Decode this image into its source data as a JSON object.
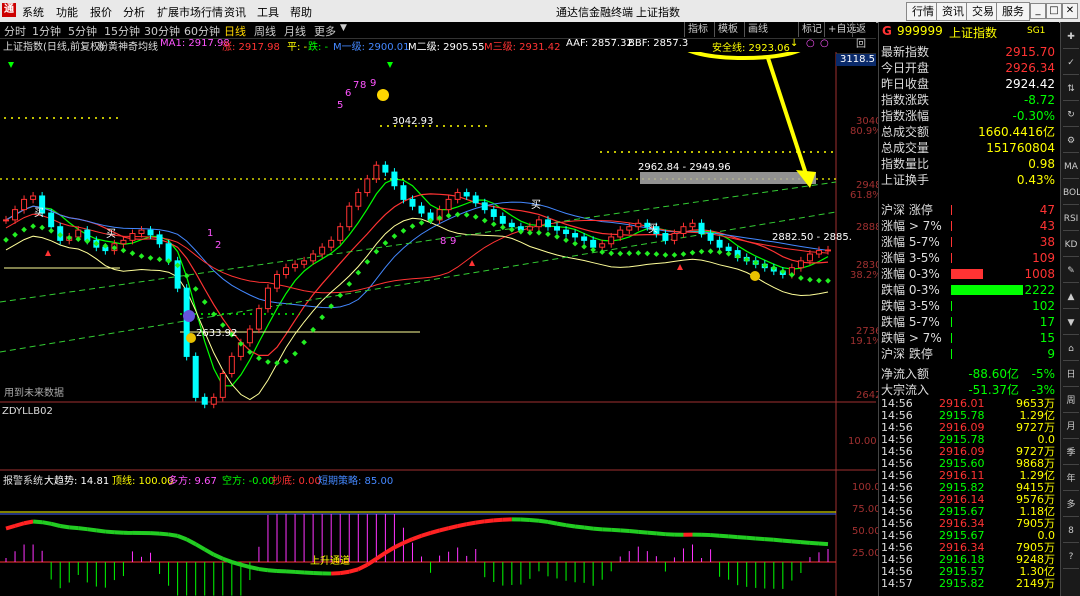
{
  "menubar": {
    "items": [
      "系统",
      "功能",
      "报价",
      "分析",
      "扩展市场行情",
      "资讯",
      "工具",
      "帮助"
    ],
    "app_title": "通达信金融终端",
    "index_title": "上证指数",
    "right_buttons": [
      "行情",
      "资讯",
      "交易",
      "服务"
    ]
  },
  "timeframes": {
    "items": [
      "分时",
      "1分钟",
      "5分钟",
      "15分钟",
      "30分钟",
      "60分钟",
      "日线",
      "周线",
      "月线",
      "更多"
    ],
    "active": "日线",
    "tools": [
      "指标",
      "模板",
      "画线",
      "标记",
      "+自选",
      "返回"
    ]
  },
  "legend": {
    "name": "上证指数(日线,前复权)",
    "indicator": "粉黄神奇均线",
    "items": [
      {
        "text": "MA1: 2917.98",
        "color": "#ff55ff"
      },
      {
        "text": "涨: 2917.98",
        "color": "#ff3333"
      },
      {
        "text": "平: -",
        "color": "#ffff00"
      },
      {
        "text": "跌: -",
        "color": "#00ff00"
      },
      {
        "text": "M一级: 2900.01",
        "color": "#4488ff"
      },
      {
        "text": "M二级: 2905.55",
        "color": "#ffffff"
      },
      {
        "text": "M三级: 2931.42",
        "color": "#ff3333"
      },
      {
        "text": "AAF: 2857.32",
        "color": "#ffffff"
      },
      {
        "text": "BBF: 2857.3",
        "color": "#ffffff"
      }
    ],
    "safety_line": "安全线: 2923.06"
  },
  "chart": {
    "price_ticks": [
      {
        "v": "3118.5",
        "pct": ""
      },
      {
        "v": "3040",
        "pct": "80.9%"
      },
      {
        "v": "2948",
        "pct": "61.8%"
      },
      {
        "v": "2888",
        "pct": ""
      },
      {
        "v": "2830",
        "pct": "38.2%"
      },
      {
        "v": "2736",
        "pct": "19.1%"
      },
      {
        "v": "2642",
        "pct": ""
      }
    ],
    "annotations": {
      "high": "3042.93",
      "low": "2633.92",
      "range1": "2962.84 - 2949.96",
      "range2": "2882.50 - 2885.",
      "future": "用到未来数据",
      "upchannel": "上升通道"
    },
    "numbers": [
      "1",
      "2",
      "3",
      "4",
      "5",
      "6",
      "7",
      "8",
      "9"
    ],
    "buy_mark": "买",
    "sell_mark": "卖",
    "sub1": {
      "name": "ZDYLLB02",
      "tick": "10.00"
    },
    "sub2": {
      "name": "报警系统",
      "items": [
        {
          "text": "大趋势: 14.81",
          "color": "#ffffff"
        },
        {
          "text": "顶线: 100.00",
          "color": "#ffff00"
        },
        {
          "text": "多方: 9.67",
          "color": "#ff55ff"
        },
        {
          "text": "空方: -0.00",
          "color": "#00ff00"
        },
        {
          "text": "抄底: 0.00",
          "color": "#ff3333"
        },
        {
          "text": "短期策略: 85.00",
          "color": "#4488ff"
        }
      ],
      "ticks": [
        "100.0",
        "75.00",
        "50.00",
        "25.00"
      ]
    }
  },
  "rightpanel": {
    "code": "999999",
    "name": "上证指数",
    "tag": "SG1",
    "stats": [
      {
        "label": "最新指数",
        "value": "2915.70",
        "color": "#ff3333"
      },
      {
        "label": "今日开盘",
        "value": "2926.34",
        "color": "#ff3333"
      },
      {
        "label": "昨日收盘",
        "value": "2924.42",
        "color": "#ffffff"
      },
      {
        "label": "指数涨跌",
        "value": "-8.72",
        "color": "#00ff00"
      },
      {
        "label": "指数涨幅",
        "value": "-0.30%",
        "color": "#00ff00"
      },
      {
        "label": "总成交额",
        "value": "1660.4416亿",
        "color": "#ffff00"
      },
      {
        "label": "总成交量",
        "value": "151760804",
        "color": "#ffff00"
      },
      {
        "label": "指数量比",
        "value": "0.98",
        "color": "#ffff00"
      },
      {
        "label": "上证换手",
        "value": "0.43%",
        "color": "#ffff00"
      }
    ],
    "breadth": [
      {
        "label": "沪深 涨停",
        "value": "47",
        "color": "#ff3333",
        "bar": 0.0
      },
      {
        "label": "涨幅 > 7%",
        "value": "43",
        "color": "#ff3333",
        "bar": 0.0
      },
      {
        "label": "涨幅 5-7%",
        "value": "38",
        "color": "#ff3333",
        "bar": 0.0
      },
      {
        "label": "涨幅 3-5%",
        "value": "109",
        "color": "#ff3333",
        "bar": 0.02
      },
      {
        "label": "涨幅 0-3%",
        "value": "1008",
        "color": "#ff3333",
        "bar": 0.45
      },
      {
        "label": "跌幅 0-3%",
        "value": "2222",
        "color": "#00ff00",
        "bar": 1.0
      },
      {
        "label": "跌幅 3-5%",
        "value": "102",
        "color": "#00ff00",
        "bar": 0.02
      },
      {
        "label": "跌幅 5-7%",
        "value": "17",
        "color": "#00ff00",
        "bar": 0.0
      },
      {
        "label": "跌幅 > 7%",
        "value": "15",
        "color": "#00ff00",
        "bar": 0.0
      },
      {
        "label": "沪深 跌停",
        "value": "9",
        "color": "#00ff00",
        "bar": 0.0
      }
    ],
    "flows": [
      {
        "label": "净流入额",
        "value": "-88.60亿",
        "pct": "-5%"
      },
      {
        "label": "大宗流入",
        "value": "-51.37亿",
        "pct": "-3%"
      }
    ],
    "ticks": [
      {
        "t": "14:56",
        "p": "2916.01",
        "v": "9653万",
        "pc": "#ff3333"
      },
      {
        "t": "14:56",
        "p": "2915.78",
        "v": "1.29亿",
        "pc": "#00ff00"
      },
      {
        "t": "14:56",
        "p": "2916.09",
        "v": "9727万",
        "pc": "#ff3333"
      },
      {
        "t": "14:56",
        "p": "2915.78",
        "v": "0.0",
        "pc": "#00ff00"
      },
      {
        "t": "14:56",
        "p": "2916.09",
        "v": "9727万",
        "pc": "#ff3333"
      },
      {
        "t": "14:56",
        "p": "2915.60",
        "v": "9868万",
        "pc": "#00ff00"
      },
      {
        "t": "14:56",
        "p": "2916.11",
        "v": "1.29亿",
        "pc": "#ff3333"
      },
      {
        "t": "14:56",
        "p": "2915.82",
        "v": "9415万",
        "pc": "#00ff00"
      },
      {
        "t": "14:56",
        "p": "2916.14",
        "v": "9576万",
        "pc": "#ff3333"
      },
      {
        "t": "14:56",
        "p": "2915.67",
        "v": "1.18亿",
        "pc": "#00ff00"
      },
      {
        "t": "14:56",
        "p": "2916.34",
        "v": "7905万",
        "pc": "#ff3333"
      },
      {
        "t": "14:56",
        "p": "2915.67",
        "v": "0.0",
        "pc": "#00ff00"
      },
      {
        "t": "14:56",
        "p": "2916.34",
        "v": "7905万",
        "pc": "#ff3333"
      },
      {
        "t": "14:56",
        "p": "2916.18",
        "v": "9248万",
        "pc": "#00ff00"
      },
      {
        "t": "14:56",
        "p": "2915.57",
        "v": "1.30亿",
        "pc": "#00ff00"
      },
      {
        "t": "14:57",
        "p": "2915.82",
        "v": "2149万",
        "pc": "#00ff00"
      }
    ]
  },
  "sidetools": [
    "✚",
    "✓",
    "⇅",
    "↻",
    "⚙",
    "MA",
    "BOLL",
    "RSI",
    "KD",
    "✎",
    "▲",
    "▼",
    "⌂",
    "日",
    "周",
    "月",
    "季",
    "年",
    "多",
    "8",
    "?"
  ]
}
